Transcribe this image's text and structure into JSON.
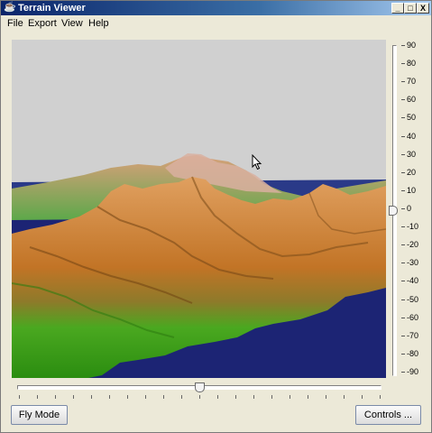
{
  "window": {
    "title": "Terrain Viewer",
    "app_icon": "java-cup-icon",
    "buttons": {
      "minimize": "_",
      "maximize": "□",
      "close": "X"
    }
  },
  "menubar": {
    "items": [
      "File",
      "Export",
      "View",
      "Help"
    ]
  },
  "vertical_slider": {
    "labels": [
      "90",
      "80",
      "70",
      "60",
      "50",
      "40",
      "30",
      "20",
      "10",
      "0",
      "-10",
      "-20",
      "-30",
      "-40",
      "-50",
      "-60",
      "-70",
      "-80",
      "-90"
    ],
    "value": 0,
    "min": -90,
    "max": 90
  },
  "horizontal_slider": {
    "value_fraction": 0.5
  },
  "buttons": {
    "fly_mode": "Fly Mode",
    "controls": "Controls ..."
  },
  "colors": {
    "sky": "#d0d0d0",
    "water": "#1c2474",
    "terrain_high": "#d98a3a",
    "terrain_low": "#3aa41c"
  }
}
